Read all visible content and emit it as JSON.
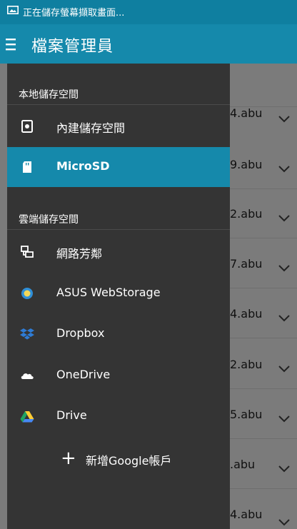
{
  "status": {
    "text": "正在儲存螢幕擷取畫面..."
  },
  "app_bar": {
    "title": "檔案管理員"
  },
  "list": {
    "rows": [
      {
        "fragment": "4.abu"
      },
      {
        "fragment": "9.abu"
      },
      {
        "fragment": "2.abu"
      },
      {
        "fragment": "7.abu"
      },
      {
        "fragment": "4.abu"
      },
      {
        "fragment": "2.abu"
      },
      {
        "fragment": "5.abu"
      },
      {
        "fragment": ".abu"
      },
      {
        "fragment": "4.abu"
      }
    ]
  },
  "drawer": {
    "local_header": "本地儲存空間",
    "local_items": [
      {
        "label": "內建儲存空間",
        "icon": "phone-storage-icon"
      },
      {
        "label": "MicroSD",
        "icon": "sd-card-icon",
        "selected": true
      }
    ],
    "cloud_header": "雲端儲存空間",
    "cloud_items": [
      {
        "label": "網路芳鄰",
        "icon": "network-icon"
      },
      {
        "label": "ASUS WebStorage",
        "icon": "asus-webstorage-icon"
      },
      {
        "label": "Dropbox",
        "icon": "dropbox-icon"
      },
      {
        "label": "OneDrive",
        "icon": "onedrive-icon"
      },
      {
        "label": "Drive",
        "icon": "google-drive-icon"
      }
    ],
    "add_account": "新增Google帳戶"
  },
  "colors": {
    "status_bar": "#0f7fa0",
    "app_bar": "#1589ab",
    "drawer_bg": "#343434",
    "selected": "#1589ab",
    "dim_list": "#7b7b7b"
  }
}
